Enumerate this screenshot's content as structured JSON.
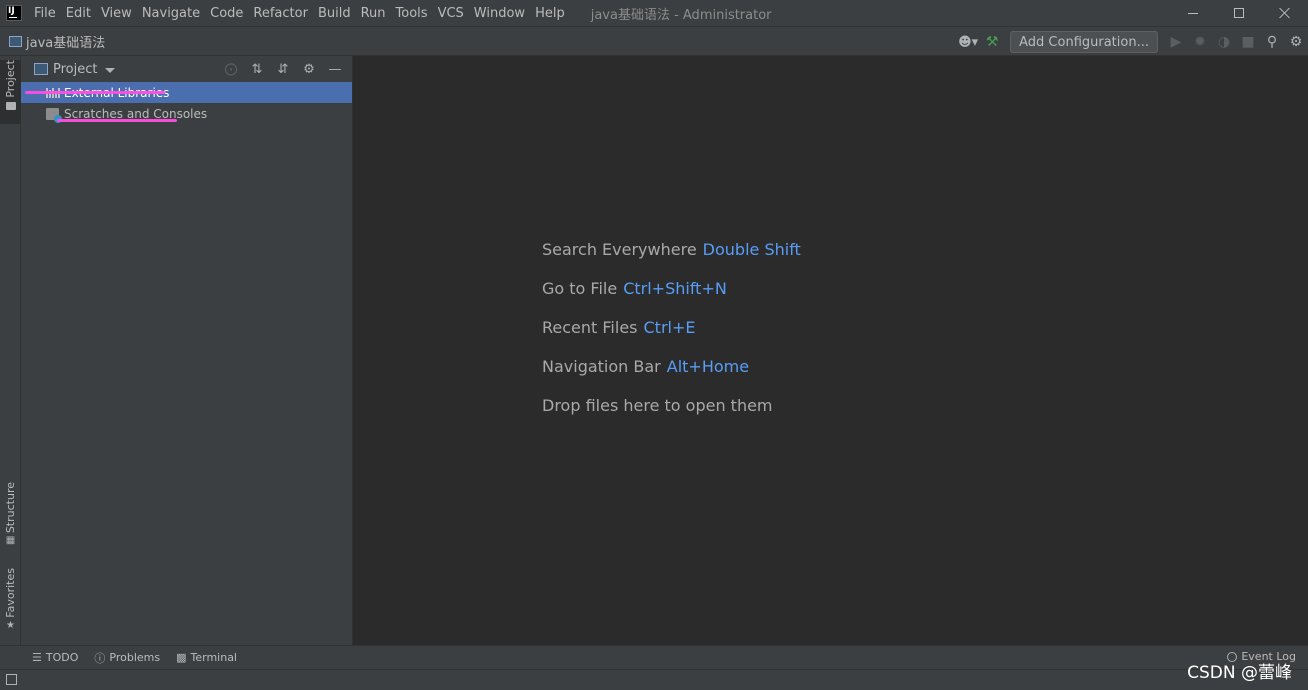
{
  "menubar": {
    "items": [
      "File",
      "Edit",
      "View",
      "Navigate",
      "Code",
      "Refactor",
      "Build",
      "Run",
      "Tools",
      "VCS",
      "Window",
      "Help"
    ],
    "window_title": "java基础语法 - Administrator"
  },
  "navbar": {
    "breadcrumb": "java基础语法",
    "add_configuration_label": "Add Configuration..."
  },
  "left_strip": {
    "project_label": "Project",
    "structure_label": "Structure",
    "favorites_label": "Favorites"
  },
  "project_panel": {
    "title": "Project",
    "tree": [
      {
        "label": "External Libraries",
        "selected": true,
        "icon": "library-icon"
      },
      {
        "label": "Scratches and Consoles",
        "selected": false,
        "icon": "scratches-icon"
      }
    ]
  },
  "editor": {
    "hints": [
      {
        "label": "Search Everywhere",
        "shortcut": "Double Shift"
      },
      {
        "label": "Go to File",
        "shortcut": "Ctrl+Shift+N"
      },
      {
        "label": "Recent Files",
        "shortcut": "Ctrl+E"
      },
      {
        "label": "Navigation Bar",
        "shortcut": "Alt+Home"
      },
      {
        "label": "Drop files here to open them",
        "shortcut": ""
      }
    ]
  },
  "bottom_bar": {
    "tabs": [
      {
        "label": "TODO",
        "icon": "todo-icon"
      },
      {
        "label": "Problems",
        "icon": "problems-icon"
      },
      {
        "label": "Terminal",
        "icon": "terminal-icon"
      }
    ],
    "event_log_label": "Event Log"
  },
  "watermark": "CSDN @蕾峰",
  "colors": {
    "selection": "#4b6eaf",
    "shortcut": "#589df6",
    "annotation": "#ff4de3",
    "build_icon": "#499c54"
  }
}
